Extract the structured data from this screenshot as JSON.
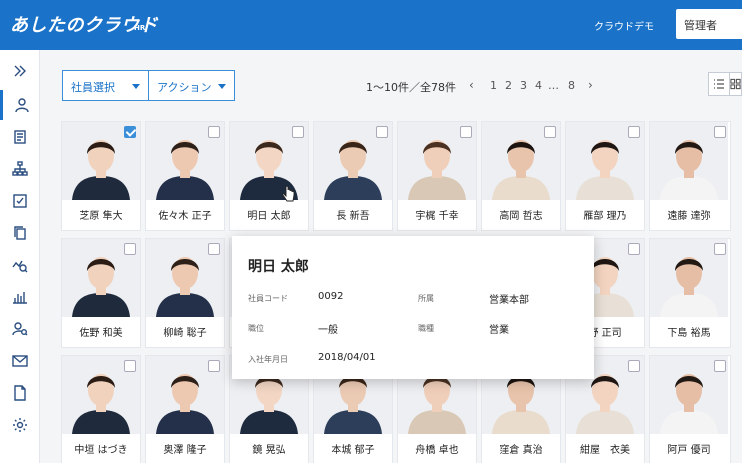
{
  "header": {
    "brand": "あしたのクラウド",
    "brand_suffix": "HR",
    "app_name": "クラウドデモ",
    "role_select": "管理者"
  },
  "sidebar": {
    "items": [
      {
        "icon": "expand-icon"
      },
      {
        "icon": "person-icon",
        "active": true
      },
      {
        "icon": "document-icon"
      },
      {
        "icon": "org-chart-icon"
      },
      {
        "icon": "checklist-icon"
      },
      {
        "icon": "copy-icon"
      },
      {
        "icon": "analytics-search-icon"
      },
      {
        "icon": "bar-chart-icon"
      },
      {
        "icon": "person-search-icon"
      },
      {
        "icon": "mail-icon"
      },
      {
        "icon": "file-icon"
      },
      {
        "icon": "gear-icon"
      }
    ]
  },
  "toolbar": {
    "employee_select": "社員選択",
    "action_select": "アクション",
    "pager_info": "1〜10件／全78件",
    "prev": "‹",
    "next": "›",
    "pages": [
      "1",
      "2",
      "3",
      "4",
      "…",
      "8"
    ]
  },
  "employees": [
    {
      "name": "芝原 隼大",
      "checked": true
    },
    {
      "name": "佐々木 正子",
      "checked": false
    },
    {
      "name": "明日 太郎",
      "checked": false
    },
    {
      "name": "長 新吾",
      "checked": false
    },
    {
      "name": "宇梶 千幸",
      "checked": false
    },
    {
      "name": "高岡 哲志",
      "checked": false
    },
    {
      "name": "雁部 理乃",
      "checked": false
    },
    {
      "name": "遠藤 達弥",
      "checked": false
    },
    {
      "name": "佐野 和美",
      "checked": false
    },
    {
      "name": "柳崎 聡子",
      "checked": false
    },
    {
      "name": "",
      "checked": false
    },
    {
      "name": "",
      "checked": false
    },
    {
      "name": "",
      "checked": false
    },
    {
      "name": "",
      "checked": false
    },
    {
      "name": "野 正司",
      "checked": false
    },
    {
      "name": "下島 裕馬",
      "checked": false
    },
    {
      "name": "中垣 はづき",
      "checked": false
    },
    {
      "name": "奥澤 隆子",
      "checked": false
    },
    {
      "name": "鏡 晃弘",
      "checked": false
    },
    {
      "name": "本城 郁子",
      "checked": false
    },
    {
      "name": "舟橋 卓也",
      "checked": false
    },
    {
      "name": "窪倉 真治",
      "checked": false
    },
    {
      "name": "紺屋　衣美",
      "checked": false
    },
    {
      "name": "阿戸 優司",
      "checked": false
    }
  ],
  "popup": {
    "name": "明日 太郎",
    "employee_code_label": "社員コード",
    "employee_code": "0092",
    "department_label": "所属",
    "department": "営業本部",
    "position_label": "職位",
    "position": "一般",
    "job_type_label": "職種",
    "job_type": "営業",
    "hire_date_label": "入社年月日",
    "hire_date": "2018/04/01"
  },
  "colors": {
    "header_bg": "#1a73c8",
    "accent": "#3a8fd8"
  }
}
